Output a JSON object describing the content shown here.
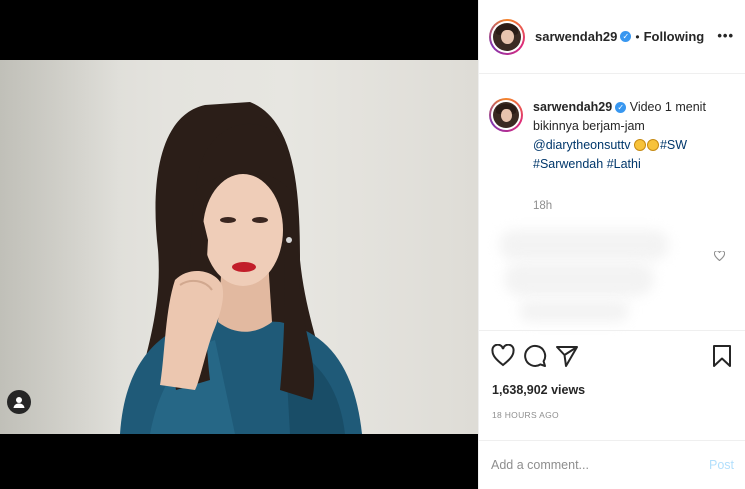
{
  "post": {
    "username": "sarwendah29",
    "verified_icon": "verified-badge-icon",
    "follow_separator": "•",
    "follow_status": "Following",
    "more_label": "•••"
  },
  "caption": {
    "username": "sarwendah29",
    "line1": "Video 1 menit",
    "line2": "bikinnya berjam-jam",
    "mention": "@diarytheonsuttv",
    "hashtag_sw": "#SW",
    "hashtag_sarwendah": "#Sarwendah",
    "hashtag_lathi": "#Lathi",
    "time": "18h"
  },
  "stats": {
    "views": "1,638,902 views",
    "posted_ago": "18 HOURS AGO"
  },
  "comment_box": {
    "placeholder": "Add a comment...",
    "post_label": "Post"
  },
  "icons": [
    "user-tag-icon",
    "heart-icon",
    "comment-icon",
    "share-icon",
    "bookmark-icon",
    "small-heart-icon",
    "laughing-emoji-icon"
  ],
  "colors": {
    "link": "#00376b",
    "verified": "#3897f0",
    "post_disabled": "#b2dffc",
    "muted": "#8e8e8e"
  }
}
